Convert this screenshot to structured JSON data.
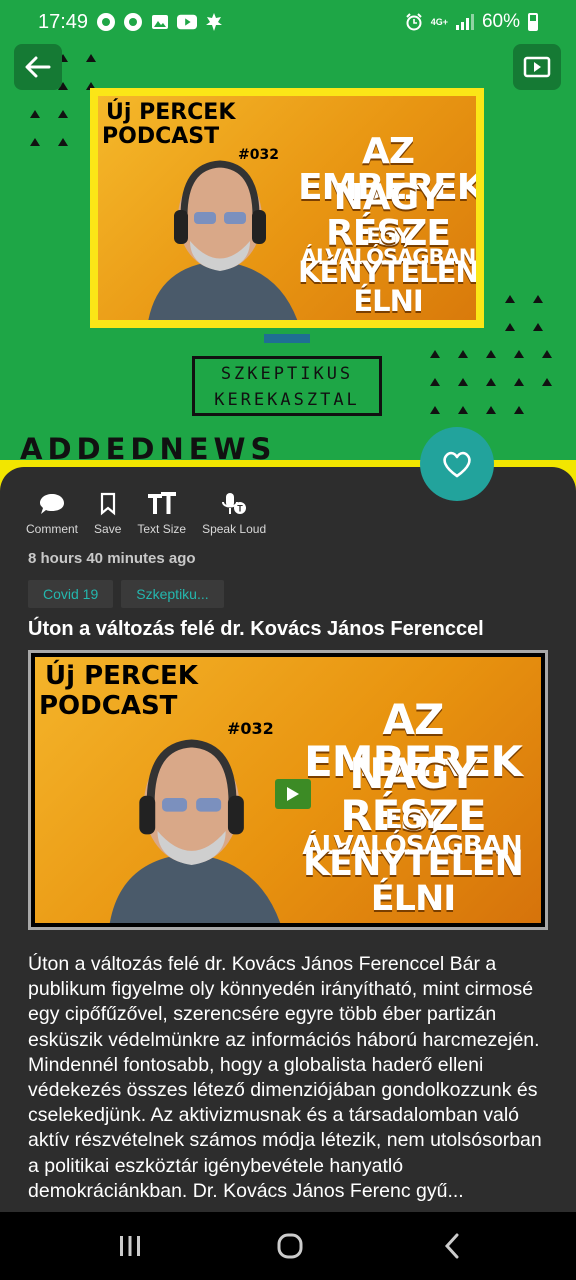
{
  "status_bar": {
    "time": "17:49",
    "network": "4G+",
    "battery": "60%"
  },
  "hero": {
    "podcast_label_line1": "Új PERCEK",
    "podcast_label_line2": "PODCAST",
    "episode": "#032",
    "headline_lines": [
      "AZ EMBEREK",
      "NAGY RÉSZE",
      "EGY ÁLVALÓSÁGBAN",
      "KÉNYTELEN ÉLNI"
    ],
    "box_line1": "SZKEPTIKUS",
    "box_line2": "KEREKASZTAL",
    "brand": "ADDEDNEWS"
  },
  "actions": [
    {
      "label": "Comment",
      "icon": "comment-icon"
    },
    {
      "label": "Save",
      "icon": "bookmark-icon"
    },
    {
      "label": "Text Size",
      "icon": "text-size-icon"
    },
    {
      "label": "Speak Loud",
      "icon": "speak-icon"
    }
  ],
  "article": {
    "time_ago": "8 hours 40 minutes ago",
    "tags": [
      "Covid 19",
      "Szkeptiku..."
    ],
    "title": "Úton a változás felé dr. Kovács János Ferenccel",
    "body": "Úton a változás felé dr. Kovács János Ferenccel Bár a publikum figyelme oly könnyedén irányítható, mint cirmosé egy cipőfűzővel, szerencsére egyre több éber partizán esküszik védelmünkre az információs háború harcmezején. Mindennél fontosabb, hogy a globalista haderő elleni védekezés összes létező dimenziójában gondolkozzunk és cselekedjünk. Az aktivizmusnak és a társadalomban való aktív részvételnek számos módja létezik, nem utolsósorban a politikai eszköztár igénybevétele hanyatló demokráciánkban. Dr. Kovács János Ferenc gyű..."
  },
  "colors": {
    "hero_green": "#1ea646",
    "accent_teal": "#22a39c",
    "sheet_bg": "#2d2d2d",
    "hero_yellow": "#f2e600"
  }
}
